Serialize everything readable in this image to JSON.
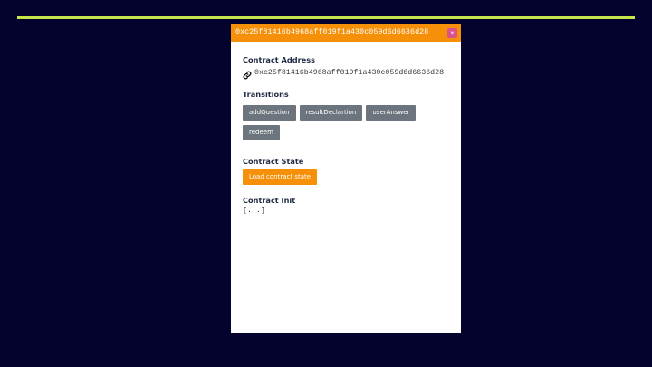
{
  "panel": {
    "title": "0xc25f81416b4968aff019f1a430c059d6d6636d28",
    "close_label": "×"
  },
  "contract_address": {
    "heading": "Contract Address",
    "icon": "link-icon",
    "value": "0xc25f81416b4968aff019f1a430c059d6d6636d28"
  },
  "transitions": {
    "heading": "Transitions",
    "items": [
      "addQuestion",
      "resultDeclartion",
      "userAnswer",
      "redeem"
    ]
  },
  "contract_state": {
    "heading": "Contract State",
    "button_label": "Load contract state"
  },
  "contract_init": {
    "heading": "Contract Init",
    "value": "[...]"
  },
  "colors": {
    "background": "#03032e",
    "accent_line": "#c8e64a",
    "header": "#f59008",
    "transition_button": "#6c757d",
    "close_button": "#d9548a"
  }
}
